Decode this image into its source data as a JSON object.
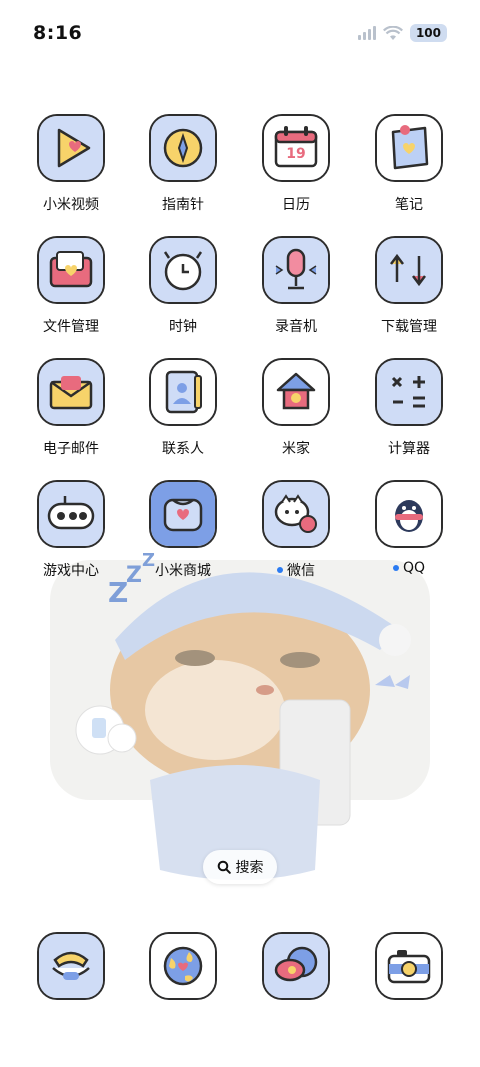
{
  "status": {
    "time": "8:16",
    "battery": "100"
  },
  "apps": [
    {
      "label": "小米视频",
      "icon": "video-play-icon"
    },
    {
      "label": "指南针",
      "icon": "compass-icon"
    },
    {
      "label": "日历",
      "icon": "calendar-icon",
      "calendar_day": "19"
    },
    {
      "label": "笔记",
      "icon": "notes-icon"
    },
    {
      "label": "文件管理",
      "icon": "folder-icon"
    },
    {
      "label": "时钟",
      "icon": "clock-icon"
    },
    {
      "label": "录音机",
      "icon": "microphone-icon"
    },
    {
      "label": "下载管理",
      "icon": "download-icon"
    },
    {
      "label": "电子邮件",
      "icon": "mail-icon"
    },
    {
      "label": "联系人",
      "icon": "contacts-icon"
    },
    {
      "label": "米家",
      "icon": "home-icon"
    },
    {
      "label": "计算器",
      "icon": "calculator-icon"
    },
    {
      "label": "游戏中心",
      "icon": "gamepad-icon"
    },
    {
      "label": "小米商城",
      "icon": "shopping-bag-icon"
    },
    {
      "label": "微信",
      "icon": "wechat-icon"
    },
    {
      "label": "QQ",
      "icon": "qq-penguin-icon"
    }
  ],
  "search": {
    "label": "搜索"
  },
  "dock": [
    {
      "icon": "phone-icon"
    },
    {
      "icon": "browser-globe-icon"
    },
    {
      "icon": "messages-icon"
    },
    {
      "icon": "camera-icon"
    }
  ]
}
